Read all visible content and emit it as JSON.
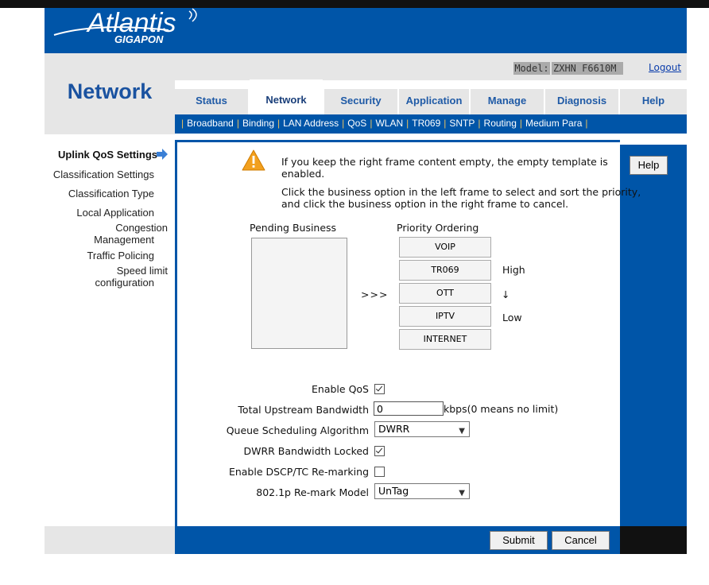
{
  "brand": {
    "name": "Atlantis",
    "sub": "GIGAPON"
  },
  "section_title": "Network",
  "model": {
    "label": "Model:",
    "value": "ZXHN F6610M"
  },
  "logout_label": "Logout",
  "tabs": [
    {
      "label": "Status"
    },
    {
      "label": "Network"
    },
    {
      "label": "Security"
    },
    {
      "label": "Application"
    },
    {
      "label": "Manage"
    },
    {
      "label": "Diagnosis"
    },
    {
      "label": "Help"
    }
  ],
  "subnav": [
    "Broadband",
    "Binding",
    "LAN Address",
    "QoS",
    "WLAN",
    "TR069",
    "SNTP",
    "Routing",
    "Medium Para"
  ],
  "leftnav": {
    "uplink": "Uplink QoS Settings",
    "classification_settings": "Classification Settings",
    "classification_type": "Classification Type",
    "local_application": "Local Application",
    "congestion_1": "Congestion",
    "congestion_2": "Management",
    "traffic_policing": "Traffic Policing",
    "speed_1": "Speed limit",
    "speed_2": "configuration"
  },
  "notice": {
    "line1": "If you keep the right frame content empty, the empty template is",
    "line2": "enabled.",
    "line3": "Click the business option in the left frame to select and sort the priority,",
    "line4": "and click the business option in the right frame to cancel."
  },
  "pending_label": "Pending Business",
  "priority_label": "Priority Ordering",
  "move_arrows": ">>>",
  "priority_items": [
    "VOIP",
    "TR069",
    "OTT",
    "IPTV",
    "INTERNET"
  ],
  "high_label": "High",
  "down_arrow": "↓",
  "low_label": "Low",
  "form": {
    "enable_qos_label": "Enable QoS",
    "enable_qos": true,
    "upstream_label": "Total Upstream Bandwidth",
    "upstream_value": "0",
    "upstream_suffix": "kbps(0 means no limit)",
    "queue_label": "Queue Scheduling Algorithm",
    "queue_value": "DWRR",
    "dwrr_label": "DWRR Bandwidth Locked",
    "dwrr_locked": true,
    "dscp_label": "Enable DSCP/TC Re-marking",
    "dscp": false,
    "remark_label": "802.1p Re-mark Model",
    "remark_value": "UnTag"
  },
  "help_label": "Help",
  "submit_label": "Submit",
  "cancel_label": "Cancel",
  "colors": {
    "primary_blue": "#0055a8",
    "gray": "#e6e6e6",
    "title_blue": "#1a52a0"
  }
}
